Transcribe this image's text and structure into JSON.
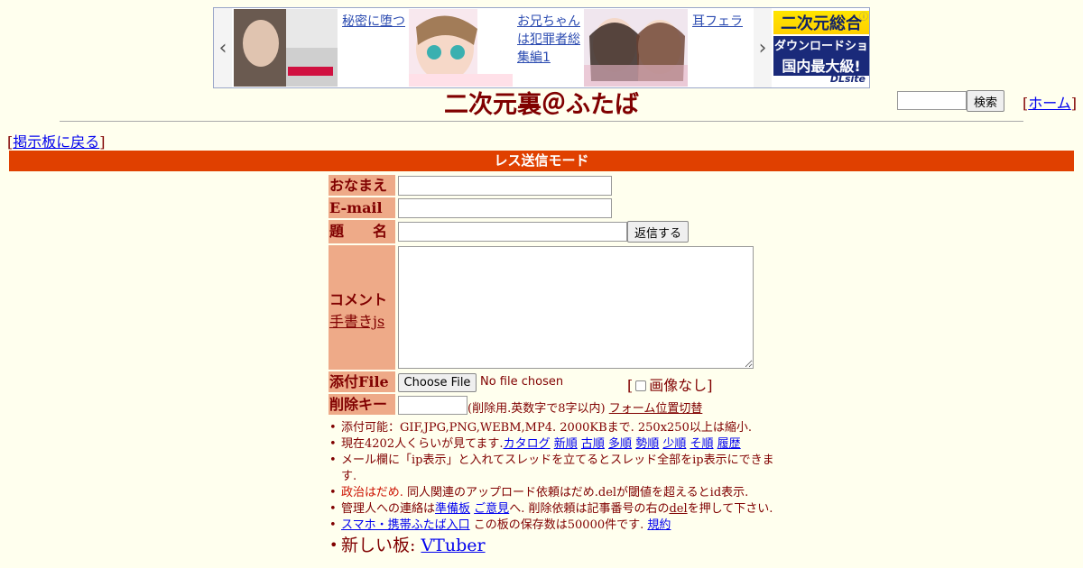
{
  "ad": {
    "items": [
      {
        "title": "秘密に堕つ"
      },
      {
        "title": "お兄ちゃんは犯罪者総集編1"
      },
      {
        "title": "耳フェラ"
      }
    ],
    "logo": {
      "line1": "二次元総合",
      "line2": "ダウンロードショップ",
      "line3": "国内最大級!",
      "brand": "DLsite"
    }
  },
  "header": {
    "title": "二次元裏＠ふたば",
    "search_button": "検索",
    "home_link": "ホーム",
    "back_link": "掲示板に戻る"
  },
  "mode_bar": "レス送信モード",
  "form": {
    "name_label": "おなまえ",
    "email_label": "E-mail",
    "subject_label": "題　　名",
    "submit_button": "返信する",
    "comment_label": "コメント",
    "tegaki_link": "手書きjs",
    "file_label": "添付File",
    "choose_file_button": "Choose File",
    "file_status": "No file chosen",
    "no_image_label": "画像なし",
    "delkey_label": "削除キー",
    "delkey_note": "(削除用.英数字で8字以内)",
    "form_switch_link": "フォーム位置切替"
  },
  "notes": {
    "n1": "添付可能：GIF,JPG,PNG,WEBM,MP4. 2000KBまで. 250x250以上は縮小.",
    "n2_prefix": "現在4202人くらいが見てます.",
    "n2_links": [
      "カタログ",
      "新順",
      "古順",
      "多順",
      "勢順",
      "少順",
      "そ順",
      "履歴"
    ],
    "n3": "メール欄に「ip表示」と入れてスレッドを立てるとスレッド全部をip表示にできます.",
    "n4_red": "政治はだめ.",
    "n4_rest": " 同人関連のアップロード依頼はだめ.delが閾値を超えるとid表示.",
    "n5_a": "管理人への連絡は",
    "n5_link1": "準備板",
    "n5_link2": "ご意見",
    "n5_b": "へ. 削除依頼は記事番号の右の",
    "n5_del": "del",
    "n5_c": "を押して下さい.",
    "n6_link": "スマホ・携帯ふたば入口",
    "n6_text": " この板の保存数は50000件です.",
    "n6_rules": "規約",
    "n7_text": "新しい板: ",
    "n7_link": "VTuber"
  }
}
